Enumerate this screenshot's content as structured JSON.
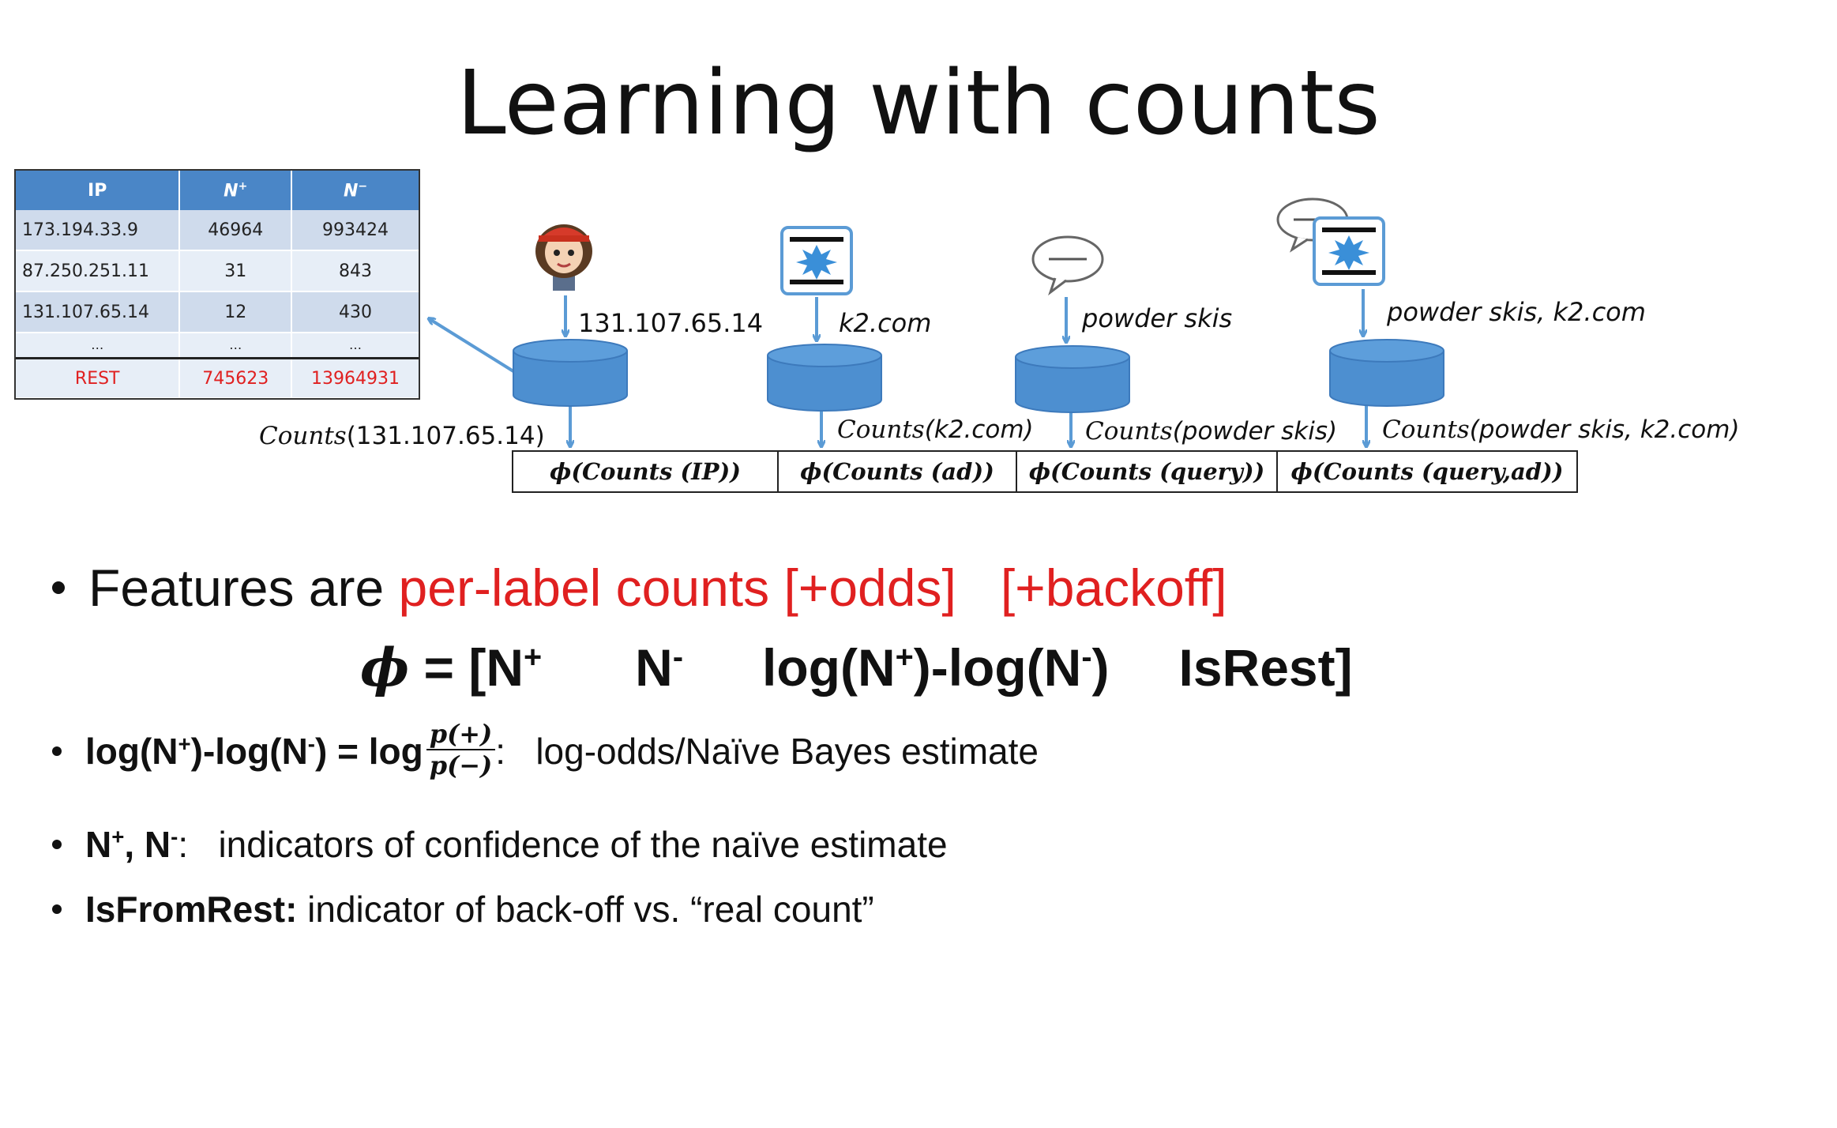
{
  "title": "Learning with counts",
  "table": {
    "headers": [
      "IP",
      "N",
      "N"
    ],
    "header_sups": [
      "",
      "+",
      "−"
    ],
    "rows": [
      [
        "173.194.33.9",
        "46964",
        "993424"
      ],
      [
        "87.250.251.11",
        "31",
        "843"
      ],
      [
        "131.107.65.14",
        "12",
        "430"
      ],
      [
        "…",
        "…",
        "…"
      ]
    ],
    "rest_row": [
      "REST",
      "745623",
      "13964931"
    ]
  },
  "diagram": {
    "inputs": [
      "131.107.65.14",
      "k2.com",
      "powder skis",
      "powder skis, k2.com"
    ],
    "counts_label": "Counts",
    "counts_args": [
      "(131.107.65.14)",
      "(k2.com)",
      "(powder skis)",
      "(powder skis, k2.com)"
    ],
    "features": [
      "ϕ(Counts (IP))",
      "ϕ(Counts (ad))",
      "ϕ(Counts (query))",
      "ϕ(Counts (query,ad))"
    ]
  },
  "bullets": {
    "b1_prefix": "Features are ",
    "b1_red": "per-label counts [+odds]",
    "b1_red2": "[+backoff]",
    "phi_symbol": "ϕ",
    "phi_parts": [
      "= [N",
      "+",
      "N",
      "-",
      "log(N",
      "+",
      ")-log(N",
      "-",
      ")",
      "IsRest]"
    ],
    "b2_bold_a": "log(N",
    "b2_bold_b": ")-log(N",
    "b2_bold_c": ") = log",
    "b2_sup_plus": "+",
    "b2_sup_minus": "-",
    "b2_frac_num": "p(+)",
    "b2_frac_den": "p(−)",
    "b2_rest": ":   log-odds/Naïve Bayes estimate",
    "b3_bold_a": "N",
    "b3_bold_b": ", N",
    "b3_sup_plus": "+",
    "b3_sup_minus": "-",
    "b3_rest": ":   indicators of confidence of the naïve estimate",
    "b4_bold": "IsFromRest:",
    "b4_rest": " indicator of back-off vs. “real count”"
  },
  "colors": {
    "accent_blue": "#4a86c7",
    "cylinder_blue": "#4d8fd0",
    "red_text": "#e02020"
  },
  "icons": [
    "user-avatar-icon",
    "ad-banner-icon",
    "speech-bubble-icon",
    "speech-bubble-ad-icon",
    "database-icon"
  ]
}
